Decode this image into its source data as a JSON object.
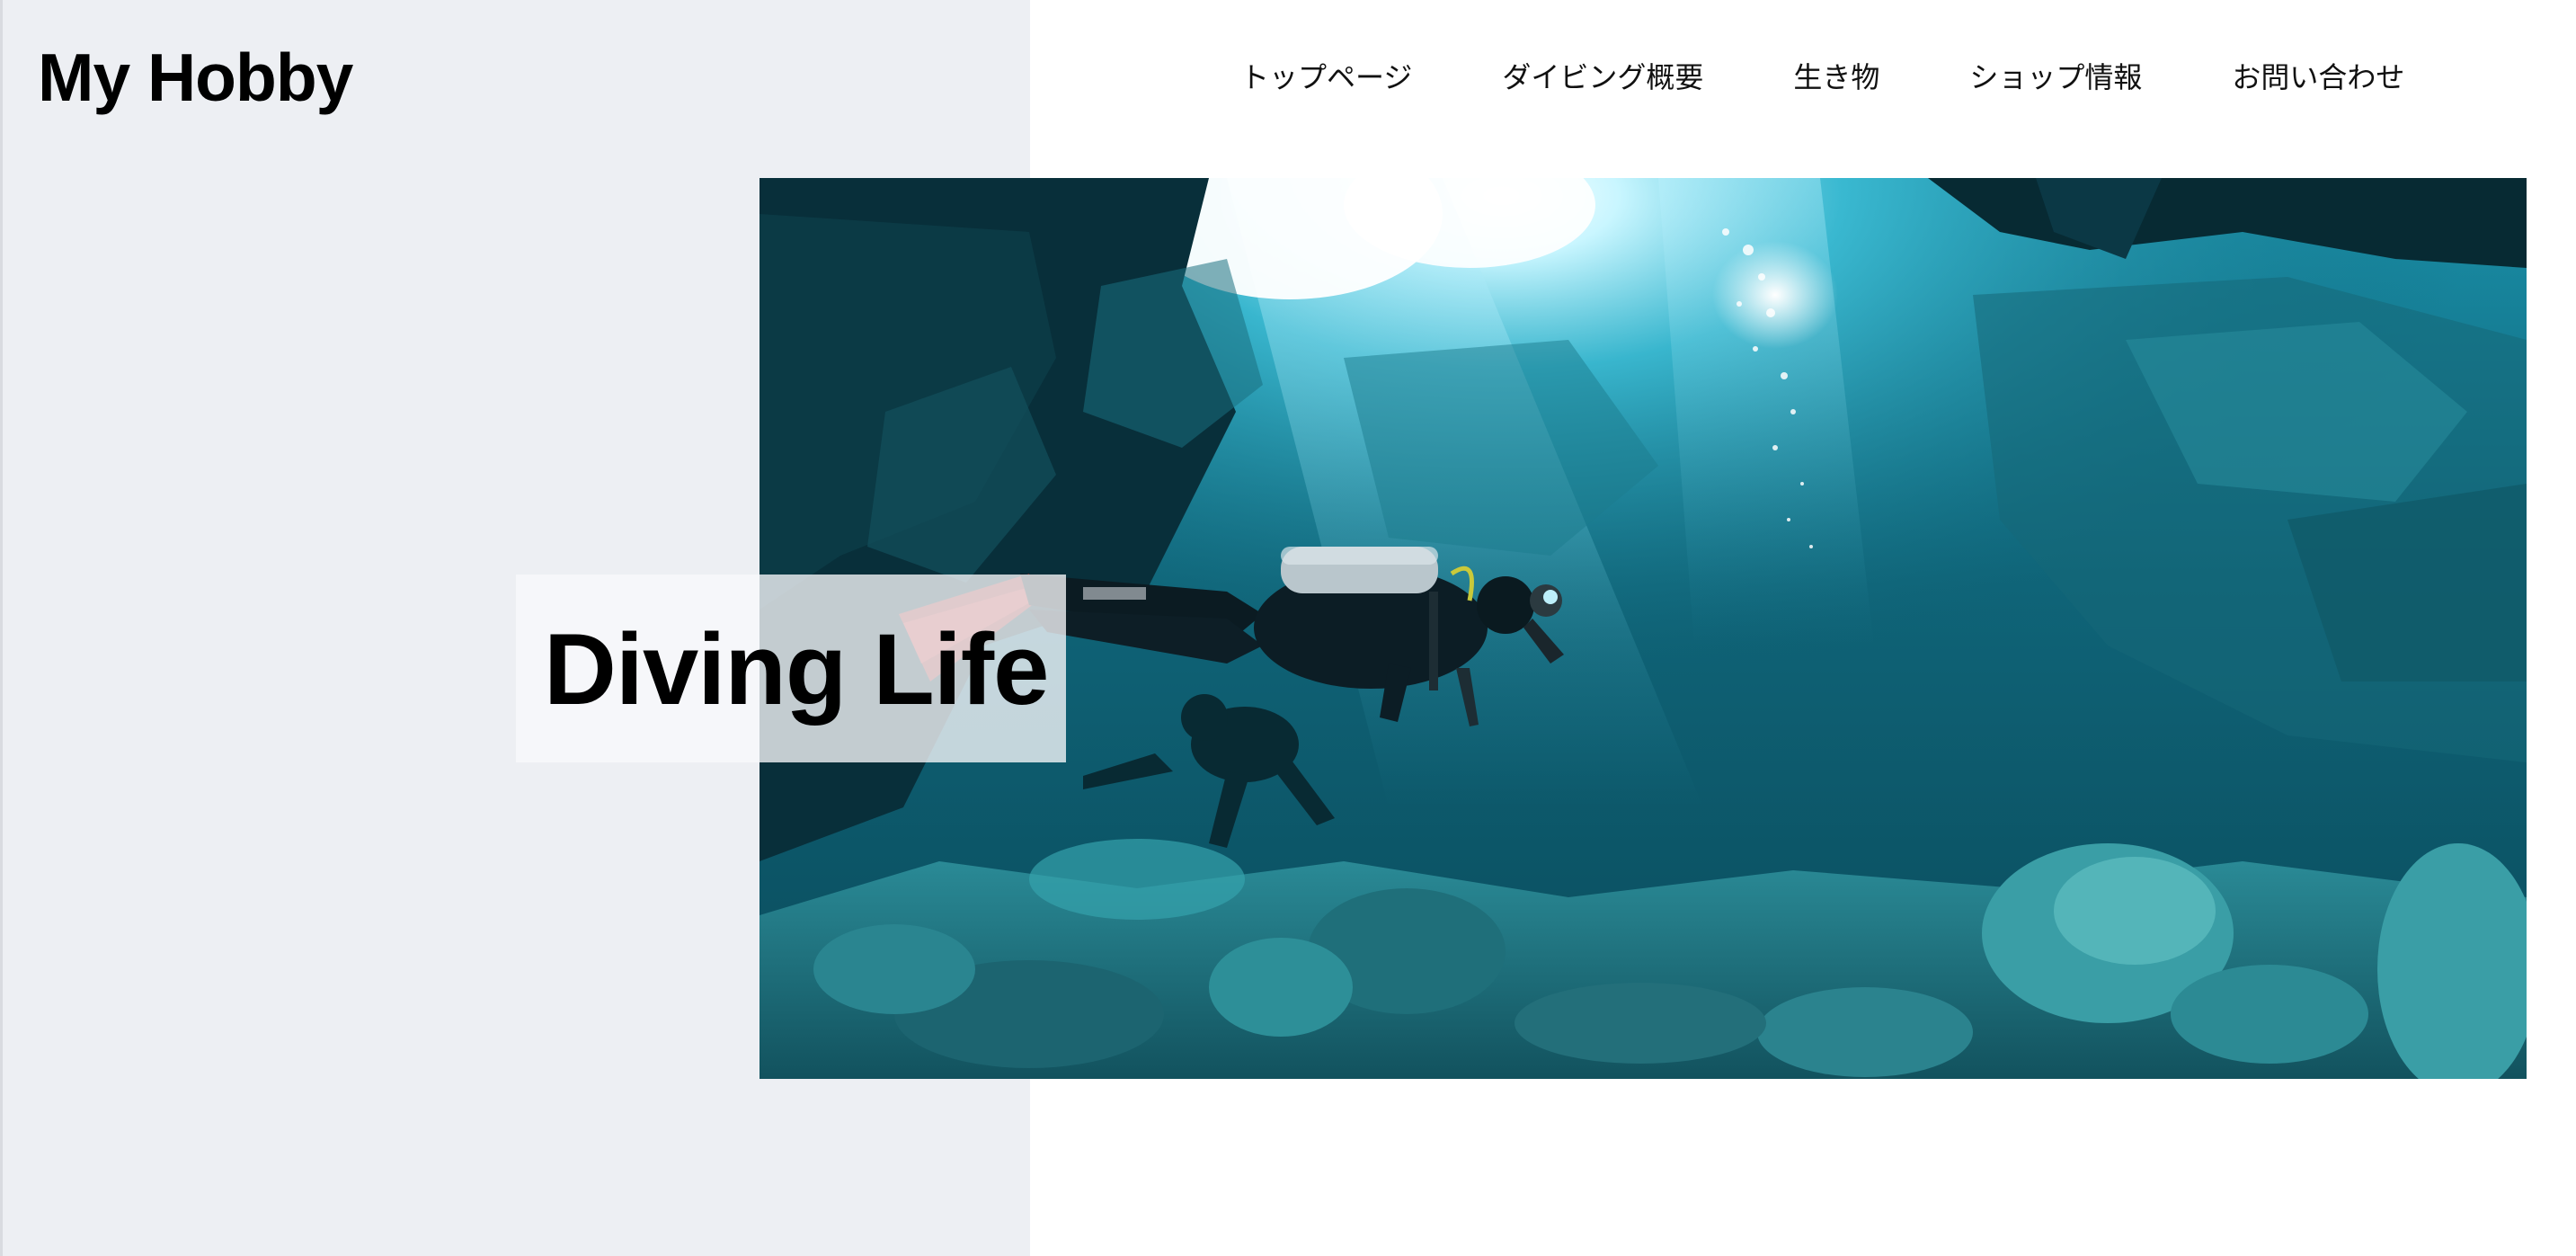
{
  "header": {
    "site_title": "My Hobby"
  },
  "nav": {
    "items": [
      {
        "label": "トップページ"
      },
      {
        "label": "ダイビング概要"
      },
      {
        "label": "生き物"
      },
      {
        "label": "ショップ情報"
      },
      {
        "label": "お問い合わせ"
      }
    ]
  },
  "hero": {
    "heading": "Diving Life",
    "image_subject": "scuba divers in an underwater cave"
  },
  "colors": {
    "left_panel_bg": "#edeff3",
    "page_bg": "#ffffff",
    "text": "#000000"
  }
}
